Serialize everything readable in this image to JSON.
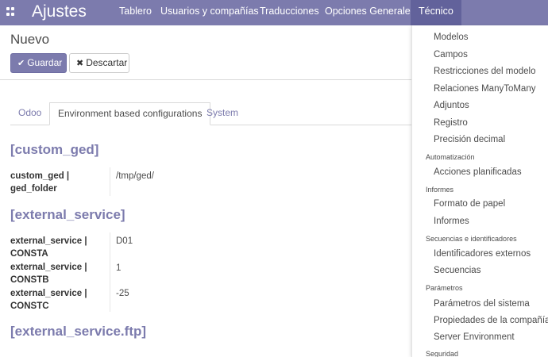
{
  "navbar": {
    "brand": "Ajustes",
    "menu": [
      "Tablero",
      "Usuarios y compañías",
      "Traducciones",
      "Opciones Generales",
      "Técnico"
    ]
  },
  "control_panel": {
    "title": "Nuevo",
    "save_label": "Guardar",
    "discard_label": "Descartar"
  },
  "tabs": [
    "Odoo",
    "Environment based configurations",
    "System"
  ],
  "sections": [
    {
      "title": "[custom_ged]",
      "fields": [
        {
          "label": "custom_ged | ged_folder",
          "value": "/tmp/ged/"
        }
      ]
    },
    {
      "title": "[external_service]",
      "fields": [
        {
          "label": "external_service | CONSTA",
          "value": "D01"
        },
        {
          "label": "external_service | CONSTB",
          "value": "1"
        },
        {
          "label": "external_service | CONSTC",
          "value": "-25"
        }
      ]
    },
    {
      "title": "[external_service.ftp]",
      "fields": []
    }
  ],
  "dropdown": {
    "items": [
      {
        "type": "item",
        "label": "Modelos"
      },
      {
        "type": "item",
        "label": "Campos"
      },
      {
        "type": "item",
        "label": "Restricciones del modelo"
      },
      {
        "type": "item",
        "label": "Relaciones ManyToMany"
      },
      {
        "type": "item",
        "label": "Adjuntos"
      },
      {
        "type": "item",
        "label": "Registro"
      },
      {
        "type": "item",
        "label": "Precisión decimal"
      },
      {
        "type": "header",
        "label": "Automatización"
      },
      {
        "type": "item",
        "label": "Acciones planificadas"
      },
      {
        "type": "header",
        "label": "Informes"
      },
      {
        "type": "item",
        "label": "Formato de papel"
      },
      {
        "type": "item",
        "label": "Informes"
      },
      {
        "type": "header",
        "label": "Secuencias e identificadores"
      },
      {
        "type": "item",
        "label": "Identificadores externos"
      },
      {
        "type": "item",
        "label": "Secuencias"
      },
      {
        "type": "header",
        "label": "Parámetros"
      },
      {
        "type": "item",
        "label": "Parámetros del sistema"
      },
      {
        "type": "item",
        "label": "Propiedades de la compañía"
      },
      {
        "type": "item",
        "label": "Server Environment"
      },
      {
        "type": "header",
        "label": "Seguridad"
      }
    ]
  },
  "colors": {
    "brand": "#7c7bad",
    "active_menu": "#62629b"
  }
}
